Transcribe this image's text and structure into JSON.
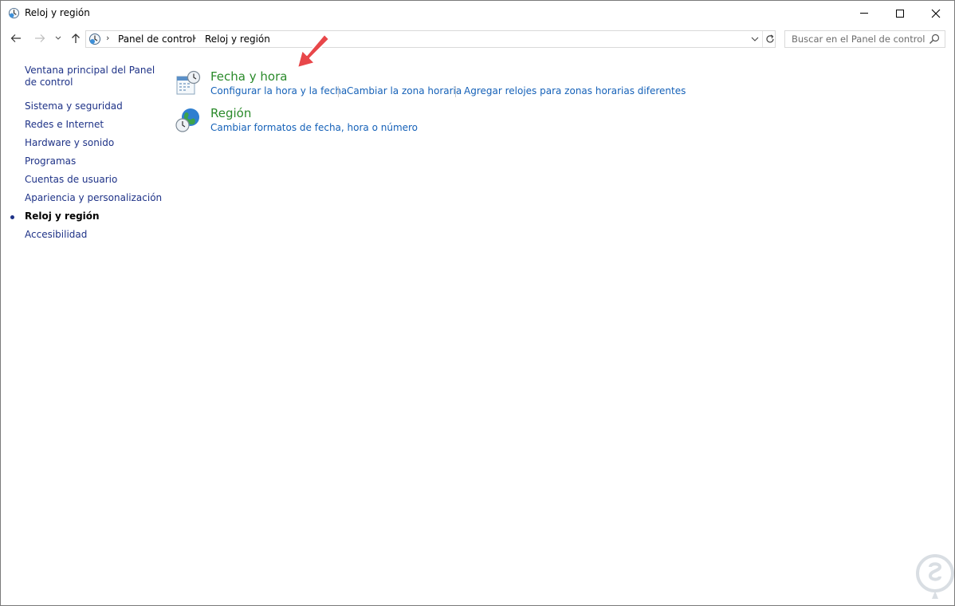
{
  "window": {
    "title": "Reloj y región",
    "controls": {
      "minimize": "minimize-icon",
      "maximize": "maximize-icon",
      "close": "close-icon"
    }
  },
  "navigation": {
    "breadcrumb": [
      "Panel de control",
      "Reloj y región"
    ],
    "search_placeholder": "Buscar en el Panel de control"
  },
  "sidebar": {
    "home_label": "Ventana principal del Panel de control",
    "items": [
      {
        "label": "Sistema y seguridad",
        "current": false
      },
      {
        "label": "Redes e Internet",
        "current": false
      },
      {
        "label": "Hardware y sonido",
        "current": false
      },
      {
        "label": "Programas",
        "current": false
      },
      {
        "label": "Cuentas de usuario",
        "current": false
      },
      {
        "label": "Apariencia y personalización",
        "current": false
      },
      {
        "label": "Reloj y región",
        "current": true
      },
      {
        "label": "Accesibilidad",
        "current": false
      }
    ]
  },
  "categories": [
    {
      "title": "Fecha y hora",
      "icon": "calendar-clock-icon",
      "links": [
        "Configurar la hora y la fecha",
        "Cambiar la zona horaria",
        "Agregar relojes para zonas horarias diferentes"
      ]
    },
    {
      "title": "Región",
      "icon": "globe-clock-icon",
      "links": [
        "Cambiar formatos de fecha, hora o número"
      ]
    }
  ],
  "colors": {
    "category_title": "#2a8a2a",
    "link": "#1561b8",
    "sidebar_link": "#1e3287",
    "annotation_arrow": "#e8474a"
  }
}
